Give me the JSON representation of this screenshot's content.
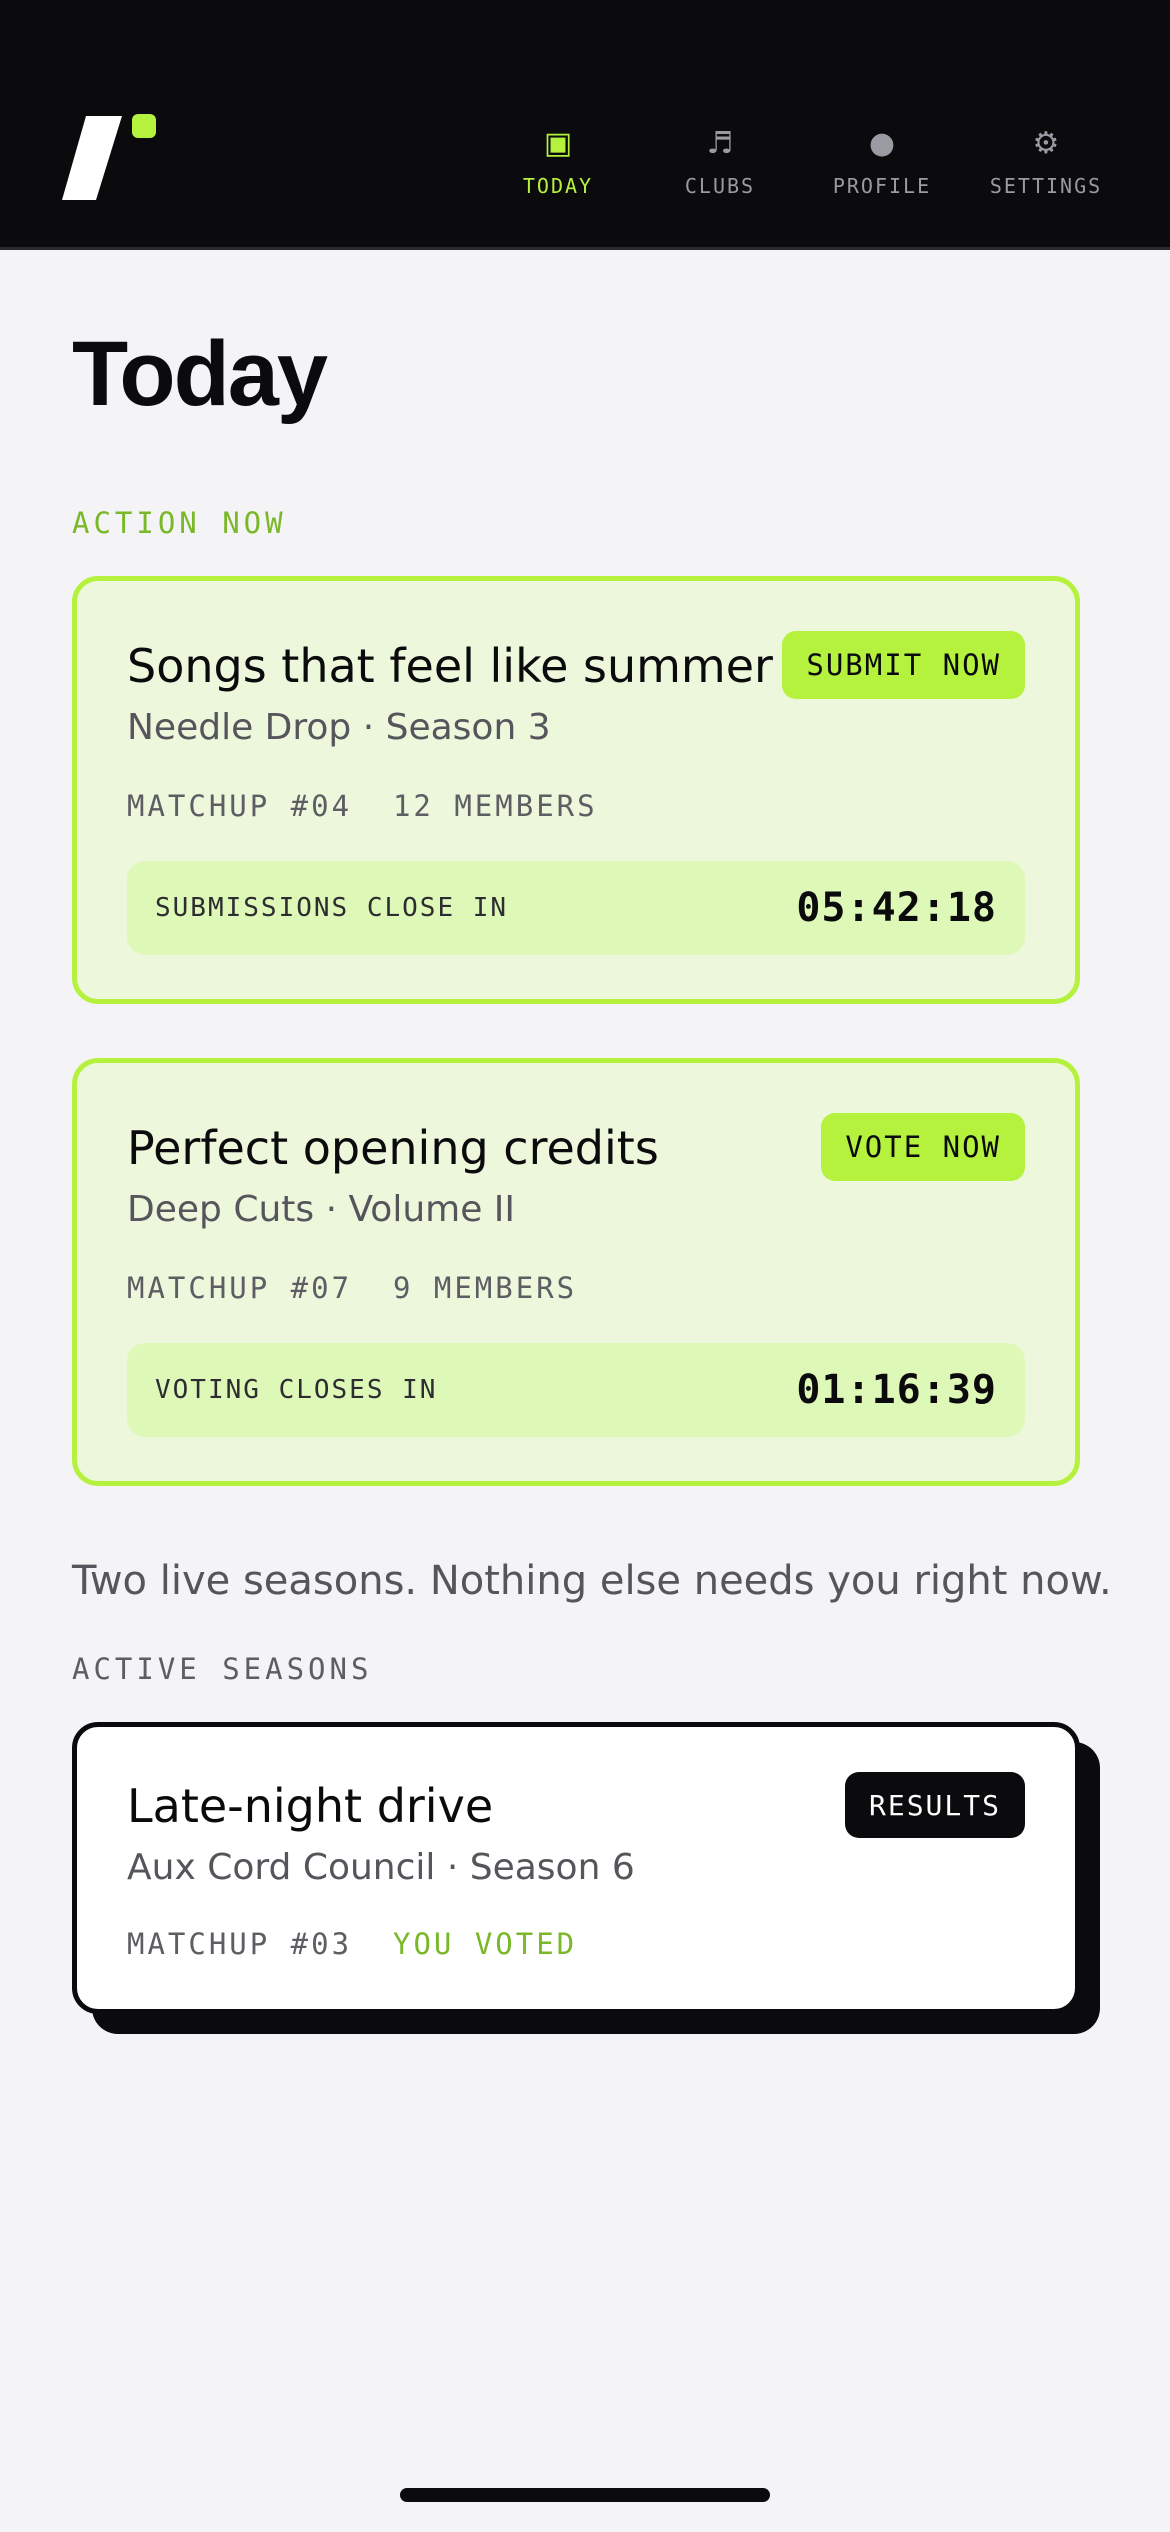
{
  "nav": {
    "items": [
      {
        "label": "TODAY",
        "icon": "today-icon",
        "glyph": "▣",
        "active": true
      },
      {
        "label": "CLUBS",
        "icon": "music-note-icon",
        "glyph": "♬",
        "active": false
      },
      {
        "label": "PROFILE",
        "icon": "profile-dot-icon",
        "glyph": "●",
        "active": false
      },
      {
        "label": "SETTINGS",
        "icon": "gear-icon",
        "glyph": "⚙",
        "active": false
      }
    ]
  },
  "page": {
    "title": "Today"
  },
  "action_now": {
    "label": "ACTION NOW",
    "cards": [
      {
        "title": "Songs that feel like summer",
        "subtitle": "Needle Drop · Season 3",
        "meta": "MATCHUP #04  12 MEMBERS",
        "cta": "SUBMIT NOW",
        "countdown_label": "SUBMISSIONS CLOSE IN",
        "countdown": "05:42:18"
      },
      {
        "title": "Perfect opening credits",
        "subtitle": "Deep Cuts · Volume II",
        "meta": "MATCHUP #07  9 MEMBERS",
        "cta": "VOTE NOW",
        "countdown_label": "VOTING CLOSES IN",
        "countdown": "01:16:39"
      }
    ]
  },
  "status_message": "Two live seasons. Nothing else needs you right now.",
  "active_seasons": {
    "label": "ACTIVE SEASONS",
    "cards": [
      {
        "title": "Late-night drive",
        "subtitle": "Aux Cord Council · Season 6",
        "matchup": "MATCHUP #03",
        "status": "YOU VOTED",
        "cta": "RESULTS"
      }
    ]
  },
  "colors": {
    "accent": "#b5f23d",
    "dark": "#0b0b0d",
    "card_bg": "#ecf7dc"
  }
}
